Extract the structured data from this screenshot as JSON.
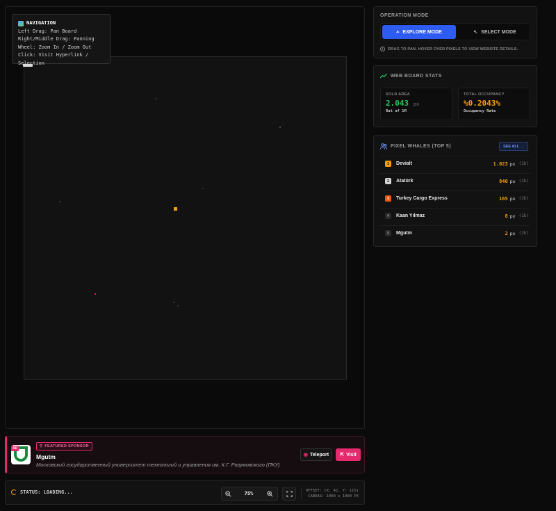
{
  "navigation_help": {
    "title": "NAVIGATION",
    "lines": [
      "Left Drag: Pan Board",
      "Right/Middle Drag: Panning",
      "Wheel: Zoom In / Zoom Out",
      "Click: Visit Hyperlink / Selection"
    ]
  },
  "sponsor": {
    "ad_label": "AD",
    "badge": "FEATURED SPONSOR",
    "name": "Mgutm",
    "description": "Московский государственный университет технологий и управления им. К.Г. Разумовского (ПКУ)",
    "teleport_label": "Teleport",
    "visit_label": "Visit",
    "accent": "#e62a6e"
  },
  "status_bar": {
    "status": "STATUS: LOADING...",
    "zoom": "75%",
    "offset": "OFFSET: [X: 42, Y: 115]",
    "canvas": "CANVAS: 1000 x 1000 PX"
  },
  "operation_mode": {
    "title": "OPERATION MODE",
    "explore_label": "EXPLORE MODE",
    "select_label": "SELECT MODE",
    "hint": "DRAG TO PAN. HOVER OVER PIXELS TO VIEW WEBSITE DETAILS.",
    "active_color": "#2f5cf0"
  },
  "stats": {
    "title": "WEB BOARD STATS",
    "sold_area": {
      "label": "SOLD AREA",
      "value": "2.043",
      "unit": "px",
      "sub": "Out of 1M"
    },
    "occupancy": {
      "label": "TOTAL OCCUPANCY",
      "value": "%0.2043%",
      "sub": "Occupancy Rate"
    }
  },
  "whales": {
    "title": "PIXEL WHALES (TOP 5)",
    "see_all": "SEE ALL →",
    "rows": [
      {
        "rank": "1",
        "name": "Devialt",
        "px": "1.023",
        "unit": "px",
        "count": "(1b)",
        "rank_color": "#f59e0b"
      },
      {
        "rank": "2",
        "name": "Atatürk",
        "px": "840",
        "unit": "px",
        "count": "(1b)",
        "rank_color": "#d4d4d4"
      },
      {
        "rank": "3",
        "name": "Turkey Cargo Express",
        "px": "165",
        "unit": "px",
        "count": "(1b)",
        "rank_color": "#ea580c"
      },
      {
        "rank": "4",
        "name": "Kaan Yılmaz",
        "px": "8",
        "unit": "px",
        "count": "(1b)",
        "rank_color": "#2a2a2a"
      },
      {
        "rank": "5",
        "name": "Mgutm",
        "px": "2",
        "unit": "px",
        "count": "(1b)",
        "rank_color": "#2a2a2a"
      }
    ]
  }
}
